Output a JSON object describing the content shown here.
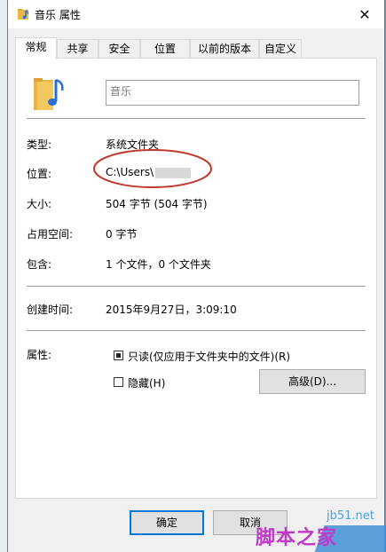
{
  "window": {
    "title": "音乐 属性",
    "close_glyph": "✕"
  },
  "tabs": [
    {
      "label": "常规",
      "active": true
    },
    {
      "label": "共享",
      "active": false
    },
    {
      "label": "安全",
      "active": false
    },
    {
      "label": "位置",
      "active": false
    },
    {
      "label": "以前的版本",
      "active": false
    },
    {
      "label": "自定义",
      "active": false
    }
  ],
  "general": {
    "folder_name": "音乐",
    "type_label": "类型:",
    "type_value": "系统文件夹",
    "location_label": "位置:",
    "location_value": "C:\\Users\\",
    "size_label": "大小:",
    "size_value": "504 字节 (504 字节)",
    "disk_label": "占用空间:",
    "disk_value": "0 字节",
    "contains_label": "包含:",
    "contains_value": "1 个文件，0 个文件夹",
    "created_label": "创建时间:",
    "created_value": "2015年9月27日，3:09:10",
    "attributes_label": "属性:",
    "readonly_label": "只读(仅应用于文件夹中的文件)(R)",
    "readonly_checked": true,
    "hidden_label": "隐藏(H)",
    "hidden_checked": false,
    "advanced_label": "高级(D)..."
  },
  "buttons": {
    "ok": "确定",
    "cancel": "取消"
  },
  "watermark": {
    "text": "脚本之家",
    "site": "jb51.net"
  },
  "colors": {
    "accent": "#0078d7",
    "annotation": "#c0392b",
    "folder": "#e8b74a",
    "note": "#2a6fd6"
  }
}
